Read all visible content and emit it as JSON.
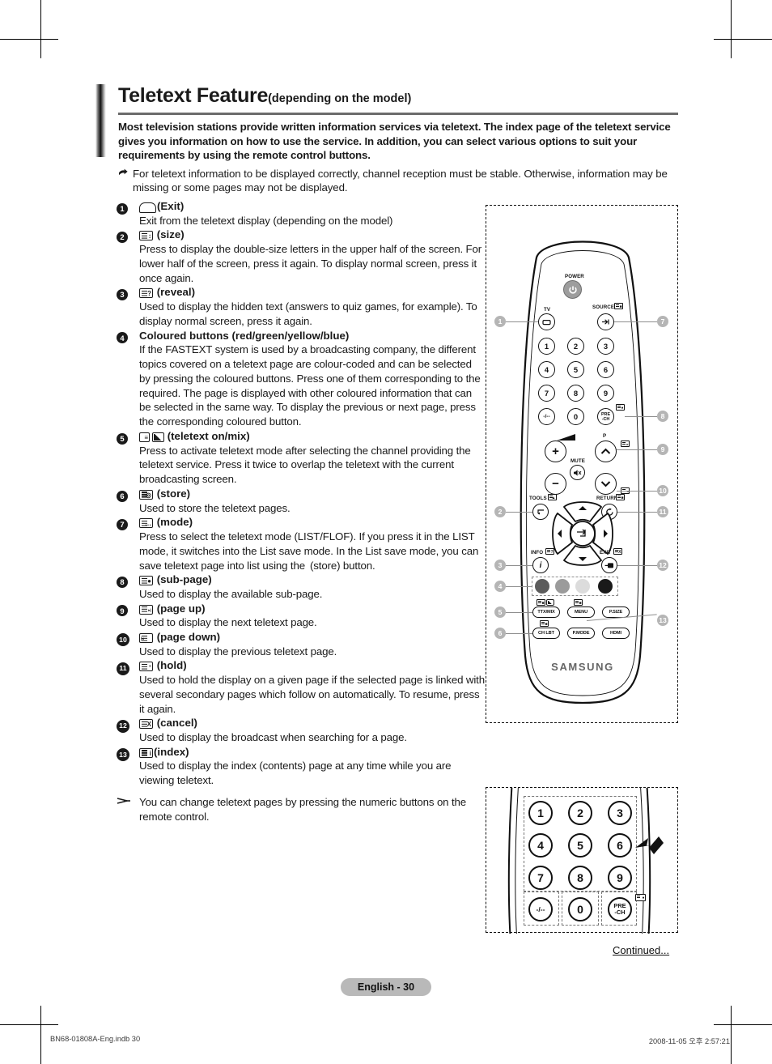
{
  "title": {
    "main": "Teletext Feature",
    "sub": "(depending on the model)"
  },
  "intro": {
    "paragraph": "Most television stations provide written information services via teletext. The index page of the teletext service gives you information on how to use the service. In addition, you can select various options to suit your requirements by using the remote control buttons.",
    "note_icon": "pointing-hand-icon",
    "note": "For teletext information to be displayed correctly, channel reception must be stable. Otherwise, information may be missing or some pages may not be displayed."
  },
  "list": [
    {
      "num": "1",
      "icon": "exit-box-icon",
      "label": "(Exit)",
      "desc": "Exit from the teletext display (depending on the model)"
    },
    {
      "num": "2",
      "icon": "teletext-size-icon",
      "glyph": "↕",
      "label": "(size)",
      "desc": "Press to display the double-size letters in the upper half of the screen. For lower half of the screen, press it again.\nTo display normal screen, press it once again."
    },
    {
      "num": "3",
      "icon": "teletext-reveal-icon",
      "glyph": "?",
      "label": "(reveal)",
      "desc": "Used to display the hidden text (answers to quiz games, for example). To display normal screen, press it again."
    },
    {
      "num": "4",
      "icon": "",
      "label": "Coloured buttons (red/green/yellow/blue)",
      "desc": "If the FASTEXT system is used by a broadcasting company, the different topics covered on a teletext page are colour-coded and can be selected by pressing the coloured buttons. Press one of them corresponding to the required. The page is displayed with other coloured information that can be selected in the same way.\nTo display the previous or next page, press the corresponding coloured button."
    },
    {
      "num": "5",
      "icon": "teletext-onmix-icon",
      "glyph": "",
      "label": "(teletext on/mix)",
      "desc": "Press to activate teletext mode after selecting the channel providing the teletext service. Press it twice to overlap the teletext with the current broadcasting screen."
    },
    {
      "num": "6",
      "icon": "teletext-store-icon",
      "glyph": "◎",
      "label": "(store)",
      "desc": "Used to store the teletext pages."
    },
    {
      "num": "7",
      "icon": "teletext-mode-icon",
      "glyph": "…",
      "label": "(mode)",
      "desc": "Press to select the teletext mode (LIST/FLOF).\nIf you press it in the LIST mode, it switches into the List save mode.\nIn the List save mode, you can save teletext page into list using the  (store) button."
    },
    {
      "num": "8",
      "icon": "teletext-subpage-icon",
      "glyph": "●",
      "label": "(sub-page)",
      "desc": "Used to display the available sub-page."
    },
    {
      "num": "9",
      "icon": "teletext-pageup-icon",
      "glyph": "▸|",
      "label": "(page up)",
      "desc": "Used to display the next teletext page."
    },
    {
      "num": "10",
      "icon": "teletext-pagedown-icon",
      "glyph": "|◂",
      "label": "(page down)",
      "desc": "Used to display the previous teletext page."
    },
    {
      "num": "11",
      "icon": "teletext-hold-icon",
      "glyph": "≡",
      "label": "(hold)",
      "desc": "Used to hold the display on a given page if the selected page is linked with several secondary pages\nwhich follow on automatically. To resume, press it again."
    },
    {
      "num": "12",
      "icon": "teletext-cancel-icon",
      "glyph": "X",
      "label": "(cancel)",
      "desc": "Used to display the broadcast when searching for a page."
    },
    {
      "num": "13",
      "icon": "teletext-index-icon",
      "glyph": "i",
      "label": "(index)",
      "desc": "Used to display the index (contents) page at any time while you are viewing teletext."
    }
  ],
  "tail_note": {
    "icon": "arrow-note-icon",
    "text": "You can change teletext pages by pressing the numeric buttons on the remote control."
  },
  "remote": {
    "brand": "SAMSUNG",
    "labels": {
      "power": "POWER",
      "tv": "TV",
      "source": "SOURCE",
      "mute": "MUTE",
      "p": "P",
      "tools": "TOOLS",
      "return": "RETURN",
      "info": "INFO",
      "exit": "EXIT",
      "prech": "PRE\n-CH"
    },
    "keys": [
      "1",
      "2",
      "3",
      "4",
      "5",
      "6",
      "7",
      "8",
      "9",
      "0"
    ],
    "dash_key": "-/--",
    "prech_key_line1": "PRE",
    "prech_key_line2": "-CH",
    "vol_plus": "+",
    "vol_minus": "−",
    "function_buttons": [
      "TTX/MIX",
      "MENU",
      "P.SIZE",
      "CH LBT",
      "P.MODE",
      "HDMI"
    ],
    "colour_buttons": [
      "red",
      "green",
      "yellow",
      "blue"
    ],
    "colour_swatches": [
      "#5c5c5c",
      "#9b9b9b",
      "#dcdcdc",
      "#1a1a1a"
    ],
    "callouts": [
      "1",
      "2",
      "3",
      "4",
      "5",
      "6",
      "7",
      "8",
      "9",
      "10",
      "11",
      "12",
      "13"
    ]
  },
  "keypad_figure": {
    "rows": [
      [
        "1",
        "2",
        "3"
      ],
      [
        "4",
        "5",
        "6"
      ],
      [
        "7",
        "8",
        "9"
      ]
    ],
    "bottom_row": [
      "-/--",
      "0",
      "PRE\n-CH"
    ],
    "prech_line1": "PRE",
    "prech_line2": "-CH",
    "pointer_icon": "arrow-pointer-icon"
  },
  "footer": {
    "continued": "Continued...",
    "page_label": "English - 30"
  },
  "printline": {
    "left": "BN68-01808A-Eng.indb   30",
    "right": "2008-11-05   오후 2:57:21"
  }
}
